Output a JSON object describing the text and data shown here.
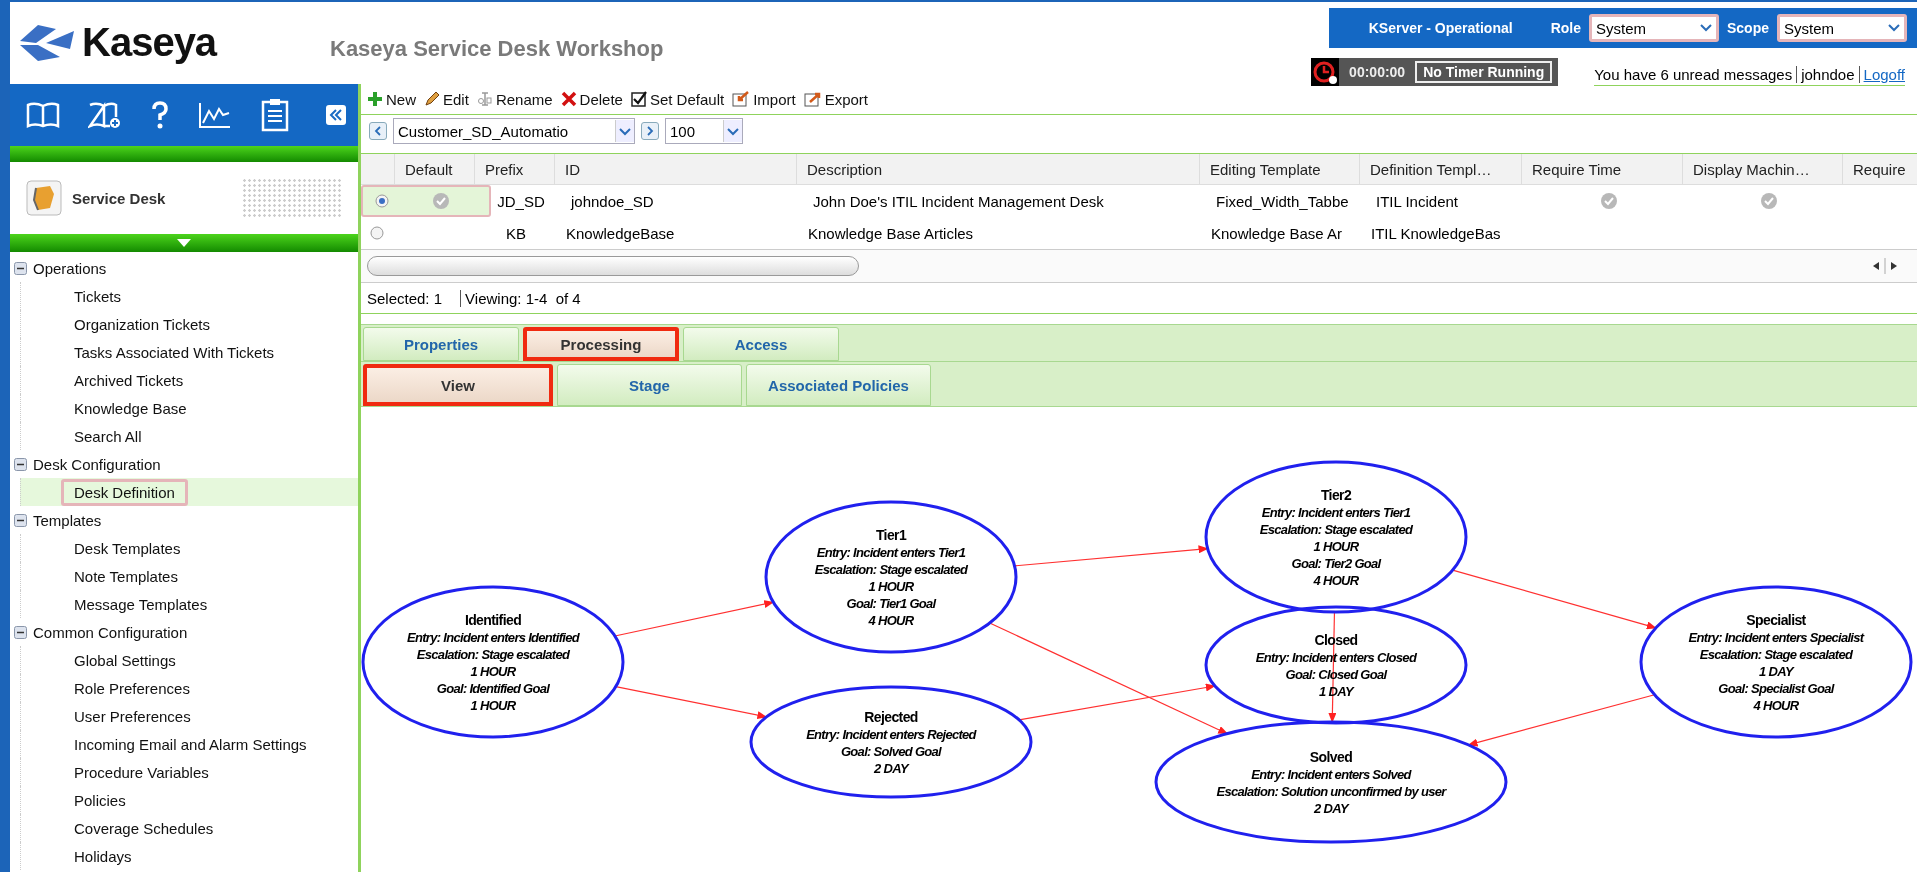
{
  "header": {
    "logo": "Kaseya",
    "title": "Kaseya Service Desk Workshop",
    "server_status": "KServer - Operational",
    "role_label": "Role",
    "role": "System",
    "scope_label": "Scope",
    "scope": "System",
    "timer": "00:00:00",
    "timer_status": "No Timer Running",
    "messages": "You have 6 unread messages",
    "user": "johndoe",
    "logoff": "Logoff"
  },
  "sidebar": {
    "module": "Service Desk",
    "tree": [
      {
        "label": "Operations",
        "expanded": true,
        "children": [
          {
            "label": "Tickets",
            "selected": false
          },
          {
            "label": "Organization Tickets",
            "selected": false
          },
          {
            "label": "Tasks Associated With Tickets",
            "selected": false
          },
          {
            "label": "Archived Tickets",
            "selected": false
          },
          {
            "label": "Knowledge Base",
            "selected": false
          },
          {
            "label": "Search All",
            "selected": false
          }
        ]
      },
      {
        "label": "Desk Configuration",
        "expanded": true,
        "children": [
          {
            "label": "Desk Definition",
            "selected": true
          }
        ]
      },
      {
        "label": "Templates",
        "expanded": true,
        "children": [
          {
            "label": "Desk Templates",
            "selected": false
          },
          {
            "label": "Note Templates",
            "selected": false
          },
          {
            "label": "Message Templates",
            "selected": false
          }
        ]
      },
      {
        "label": "Common Configuration",
        "expanded": true,
        "children": [
          {
            "label": "Global Settings",
            "selected": false
          },
          {
            "label": "Role Preferences",
            "selected": false
          },
          {
            "label": "User Preferences",
            "selected": false
          },
          {
            "label": "Incoming Email and Alarm Settings",
            "selected": false
          },
          {
            "label": "Procedure Variables",
            "selected": false
          },
          {
            "label": "Policies",
            "selected": false
          },
          {
            "label": "Coverage Schedules",
            "selected": false
          },
          {
            "label": "Holidays",
            "selected": false
          }
        ]
      }
    ]
  },
  "toolbar": [
    {
      "kind": "new",
      "label": "New"
    },
    {
      "kind": "edit",
      "label": "Edit"
    },
    {
      "kind": "rename",
      "label": "Rename"
    },
    {
      "kind": "delete",
      "label": "Delete"
    },
    {
      "kind": "default",
      "label": "Set Default"
    },
    {
      "kind": "import",
      "label": "Import"
    },
    {
      "kind": "export",
      "label": "Export"
    }
  ],
  "nav": {
    "filter": "Customer_SD_Automatio",
    "page_size": "100"
  },
  "table": {
    "columns": [
      "Default",
      "Prefix",
      "ID",
      "Description",
      "Editing Template",
      "Definition Templ…",
      "Require Time",
      "Display Machin…",
      "Require"
    ],
    "rows": [
      {
        "selected": true,
        "default": true,
        "prefix": "JD_SD",
        "id": "johndoe_SD",
        "description": "John Doe's ITIL Incident Management Desk",
        "editing_template": "Fixed_Width_Tabbe",
        "definition_template": "ITIL Incident",
        "require_time": true,
        "display_machine": true
      },
      {
        "selected": false,
        "default": false,
        "prefix": "KB",
        "id": "KnowledgeBase",
        "description": "Knowledge Base Articles",
        "editing_template": "Knowledge Base Ar",
        "definition_template": "ITIL KnowledgeBas",
        "require_time": false,
        "display_machine": false
      }
    ]
  },
  "status": {
    "selected": "Selected: 1",
    "viewing": "Viewing: 1-4  of 4"
  },
  "tabs": [
    {
      "label": "Properties",
      "selected": false
    },
    {
      "label": "Processing",
      "selected": true
    },
    {
      "label": "Access",
      "selected": false
    }
  ],
  "subtabs": [
    {
      "label": "View",
      "selected": true
    },
    {
      "label": "Stage",
      "selected": false
    },
    {
      "label": "Associated Policies",
      "selected": false
    }
  ],
  "diagram": {
    "nodes": [
      {
        "title": "Identified",
        "lines": [
          "Entry: Incident enters Identified",
          "Escalation: Stage escalated",
          "1 HOUR",
          "Goal: Identified Goal",
          "1 HOUR"
        ]
      },
      {
        "title": "Tier1",
        "lines": [
          "Entry: Incident enters Tier1",
          "Escalation: Stage escalated",
          "1 HOUR",
          "Goal: Tier1 Goal",
          "4 HOUR"
        ]
      },
      {
        "title": "Rejected",
        "lines": [
          "Entry: Incident enters Rejected",
          "Goal: Solved Goal",
          "2 DAY"
        ]
      },
      {
        "title": "Tier2",
        "lines": [
          "Entry: Incident enters Tier1",
          "Escalation: Stage escalated",
          "1 HOUR",
          "Goal: Tier2 Goal",
          "4 HOUR"
        ]
      },
      {
        "title": "Closed",
        "lines": [
          "Entry: Incident enters Closed",
          "Goal: Closed Goal",
          "1 DAY"
        ]
      },
      {
        "title": "Solved",
        "lines": [
          "Entry: Incident enters Solved",
          "Escalation: Solution unconfirmed by user",
          "2 DAY"
        ]
      },
      {
        "title": "Specialist",
        "lines": [
          "Entry: Incident enters Specialist",
          "Escalation: Stage escalated",
          "1 DAY",
          "Goal: Specialist Goal",
          "4 HOUR"
        ]
      }
    ]
  }
}
